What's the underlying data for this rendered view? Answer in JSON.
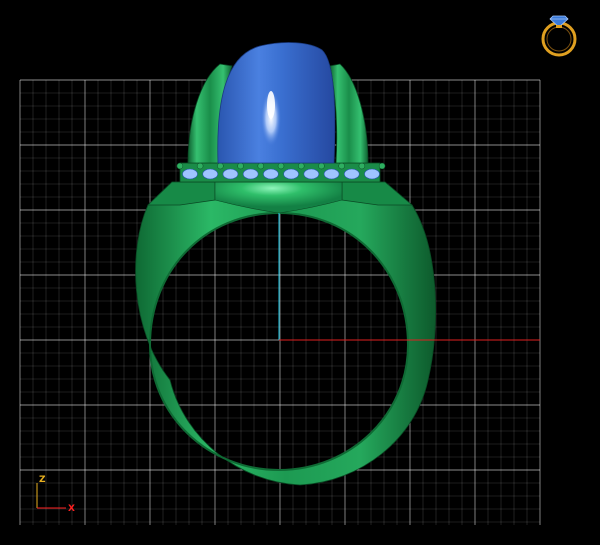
{
  "viewport": {
    "view": "front",
    "background_color": "#000000",
    "grid_color": "#ffffff",
    "grid_major_opacity": 0.55,
    "grid_minor_opacity": 0.22
  },
  "axes": {
    "vertical_axis_color": "#1ec8e6",
    "horizontal_axis_color": "#e02020"
  },
  "gizmo": {
    "z_label": "Z",
    "x_label": "X",
    "z_color": "#e8b020",
    "x_color": "#ff2020"
  },
  "model": {
    "name_icon": "ring-model",
    "metal_color": "#1f9a52",
    "metal_highlight": "#5fe898",
    "metal_shadow": "#0d5a2c",
    "stone_color": "#3a6fd0",
    "stone_highlight": "#cfe2ff",
    "accent_stone_color": "#9fc4ff",
    "prong_color": "#2eaf60"
  },
  "preview": {
    "icon": "ring-preview-icon",
    "band_color": "#e0a020",
    "gem_color": "#3a7ad8"
  }
}
